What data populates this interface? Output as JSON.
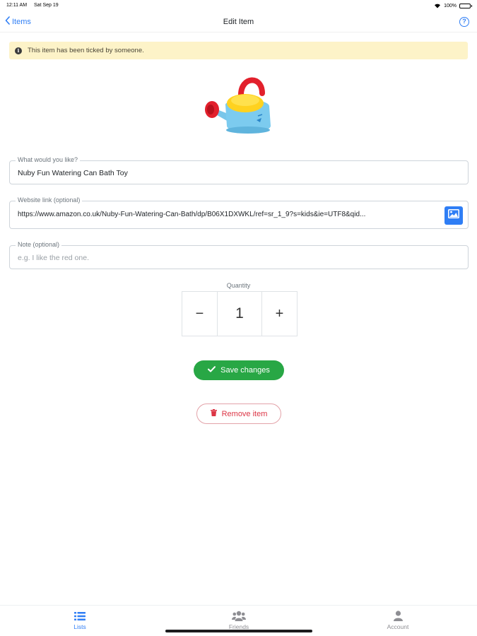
{
  "status_bar": {
    "time": "12:11 AM",
    "date": "Sat Sep 19",
    "battery": "100%"
  },
  "nav": {
    "back_label": "Items",
    "title": "Edit Item",
    "help_icon": "question-circle-icon"
  },
  "alert": {
    "text": "This item has been ticked by someone.",
    "icon": "info-icon",
    "background": "#fdf3c8"
  },
  "product_image": {
    "icon": "watering-can-image"
  },
  "form": {
    "name": {
      "label": "What would you like?",
      "value": "Nuby Fun Watering Can Bath Toy"
    },
    "link": {
      "label": "Website link (optional)",
      "value": "https://www.amazon.co.uk/Nuby-Fun-Watering-Can-Bath/dp/B06X1DXWKL/ref=sr_1_9?s=kids&ie=UTF8&qid...",
      "button_icon": "image-icon"
    },
    "note": {
      "label": "Note (optional)",
      "placeholder": "e.g. I like the red one.",
      "value": ""
    }
  },
  "quantity": {
    "label": "Quantity",
    "decrement": "−",
    "value": "1",
    "increment": "+"
  },
  "actions": {
    "save_label": "Save changes",
    "save_color": "#28a745",
    "remove_label": "Remove item",
    "remove_color": "#dc3545"
  },
  "tabs": [
    {
      "label": "Lists",
      "icon": "list-icon",
      "active": true
    },
    {
      "label": "Friends",
      "icon": "users-icon",
      "active": false
    },
    {
      "label": "Account",
      "icon": "user-icon",
      "active": false
    }
  ],
  "colors": {
    "accent": "#2f7ef5"
  }
}
